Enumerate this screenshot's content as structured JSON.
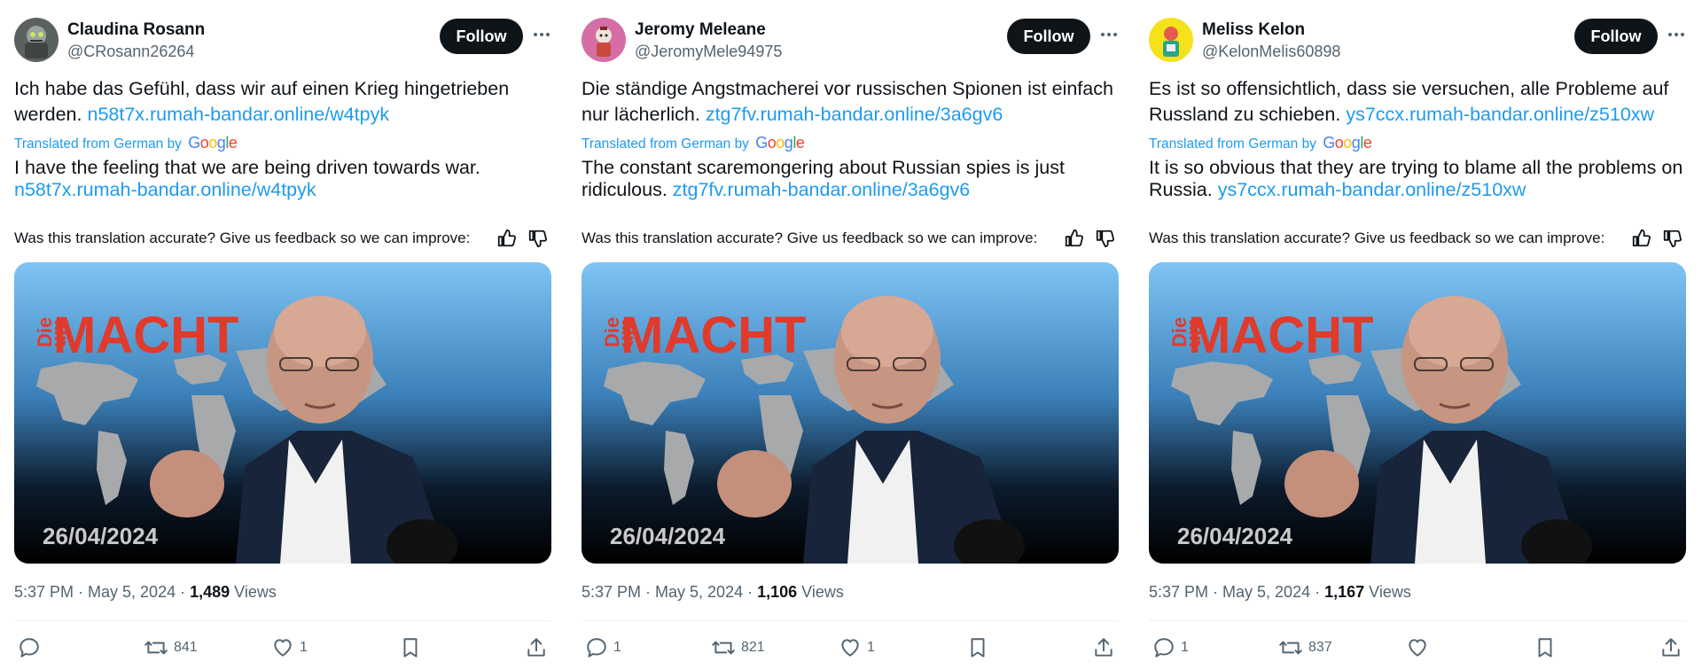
{
  "colors": {
    "link": "#1d9bf0",
    "text": "#0f1419",
    "muted": "#536471",
    "follow_bg": "#0f1419"
  },
  "follow_label": "Follow",
  "translated_label": "Translated from German by",
  "google_letters": [
    "G",
    "o",
    "o",
    "g",
    "l",
    "e"
  ],
  "feedback_text": "Was this translation accurate? Give us feedback so we can improve:",
  "views_label": "Views",
  "media": {
    "title_line1": "Die",
    "title_line2": "um",
    "title_big": "MACHT",
    "date": "26/04/2024"
  },
  "tweets": [
    {
      "name": "Claudina Rosann",
      "handle": "@CRosann26264",
      "original_text": "Ich habe das Gefühl, dass wir auf einen Krieg hingetrieben werden.",
      "original_link": "n58t7x.rumah-bandar.online/w4tpyk",
      "translated_text": "I have the feeling that we are being driven towards war.",
      "translated_link": "n58t7x.rumah-bandar.online/w4tpyk",
      "time": "5:37 PM · May 5, 2024 · ",
      "views": "1,489",
      "replies": "",
      "retweets": "841",
      "likes": "1"
    },
    {
      "name": "Jeromy Meleane",
      "handle": "@JeromyMele94975",
      "original_text": "Die ständige Angstmacherei vor russischen Spionen ist einfach nur lächerlich.",
      "original_link": "ztg7fv.rumah-bandar.online/3a6gv6",
      "translated_text": "The constant scaremongering about Russian spies is just ridiculous.",
      "translated_link": "ztg7fv.rumah-bandar.online/3a6gv6",
      "time": "5:37 PM · May 5, 2024 · ",
      "views": "1,106",
      "replies": "1",
      "retweets": "821",
      "likes": "1"
    },
    {
      "name": "Meliss Kelon",
      "handle": "@KelonMelis60898",
      "original_text": "Es ist so offensichtlich, dass sie versuchen, alle Probleme auf Russland zu schieben.",
      "original_link": "ys7ccx.rumah-bandar.online/z510xw",
      "translated_text": "It is so obvious that they are trying to blame all the problems on Russia.",
      "translated_link": "ys7ccx.rumah-bandar.online/z510xw",
      "time": "5:37 PM · May 5, 2024 · ",
      "views": "1,167",
      "replies": "1",
      "retweets": "837",
      "likes": ""
    }
  ]
}
